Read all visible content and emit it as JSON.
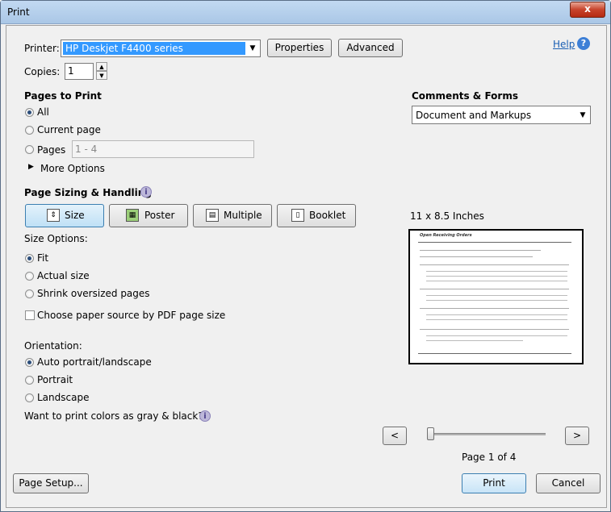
{
  "window": {
    "title": "Print",
    "close_label": "x"
  },
  "printer": {
    "label": "Printer:",
    "value": "HP Deskjet F4400 series",
    "properties": "Properties",
    "advanced": "Advanced"
  },
  "help": {
    "label": "Help",
    "icon": "?"
  },
  "copies": {
    "label": "Copies:",
    "value": "1"
  },
  "pages": {
    "heading": "Pages to Print",
    "all": "All",
    "current": "Current page",
    "pages": "Pages",
    "range_placeholder": "1 - 4",
    "more": "More Options"
  },
  "comments": {
    "heading": "Comments & Forms",
    "value": "Document and Markups"
  },
  "sizing": {
    "heading": "Page Sizing & Handling",
    "size": "Size",
    "poster": "Poster",
    "multiple": "Multiple",
    "booklet": "Booklet"
  },
  "size_options": {
    "heading": "Size Options:",
    "fit": "Fit",
    "actual": "Actual size",
    "shrink": "Shrink oversized pages",
    "paper_source": "Choose paper source by PDF page size"
  },
  "orientation": {
    "heading": "Orientation:",
    "auto": "Auto portrait/landscape",
    "portrait": "Portrait",
    "landscape": "Landscape"
  },
  "gray": {
    "label": "Want to print colors as gray & black?"
  },
  "preview": {
    "size_label": "11 x 8.5 Inches",
    "doc_title": "Open Receiving Orders",
    "page_label": "Page 1 of 4",
    "prev": "<",
    "next": ">"
  },
  "footer": {
    "page_setup": "Page Setup...",
    "print": "Print",
    "cancel": "Cancel"
  }
}
